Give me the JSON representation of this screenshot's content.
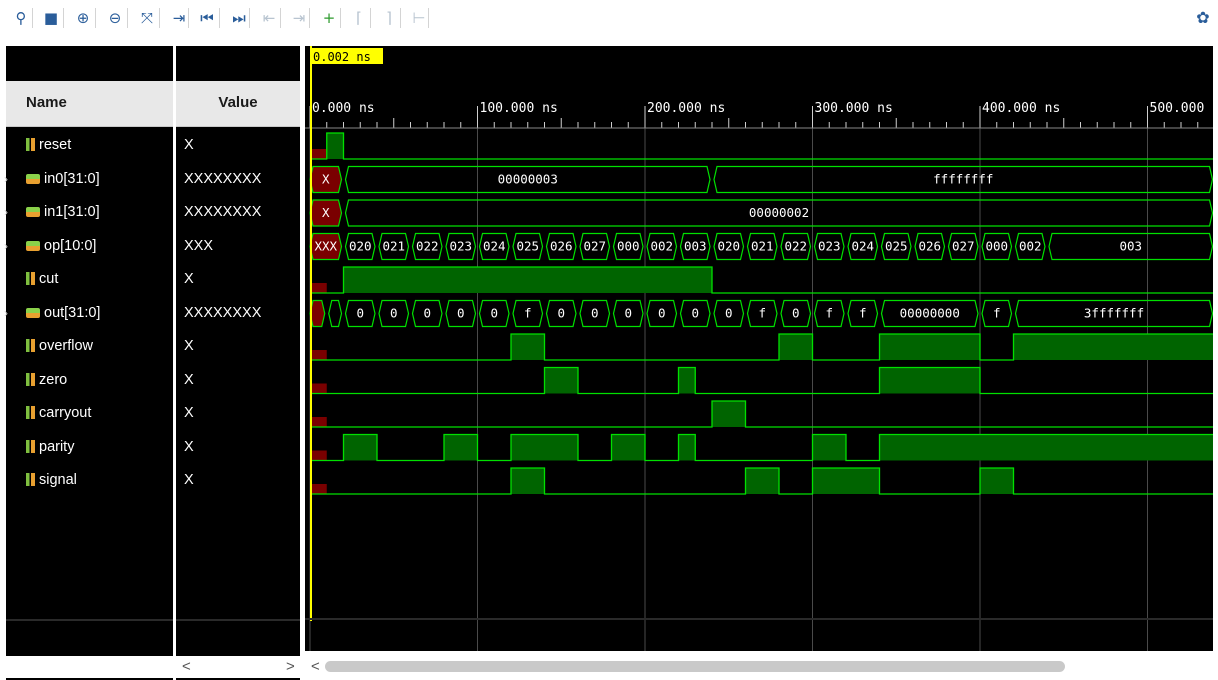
{
  "toolbar": {
    "buttons": [
      {
        "icon": "search-icon",
        "glyph": "⚲",
        "state": "enabled"
      },
      {
        "icon": "save-icon",
        "glyph": "■",
        "state": "enabled"
      },
      {
        "icon": "zoom-in-icon",
        "glyph": "⊕",
        "state": "enabled"
      },
      {
        "icon": "zoom-out-icon",
        "glyph": "⊖",
        "state": "enabled"
      },
      {
        "icon": "zoom-fit-icon",
        "glyph": "⤧",
        "state": "enabled"
      },
      {
        "icon": "go-to-cursor-icon",
        "glyph": "⇥",
        "state": "enabled"
      },
      {
        "icon": "go-to-time-zero-icon",
        "glyph": "⏮",
        "state": "enabled"
      },
      {
        "icon": "go-to-last-time-icon",
        "glyph": "⏭",
        "state": "enabled"
      },
      {
        "icon": "previous-transition-icon",
        "glyph": "⇤",
        "state": "disabled"
      },
      {
        "icon": "next-transition-icon",
        "glyph": "⇥",
        "state": "disabled"
      },
      {
        "icon": "add-marker-icon",
        "glyph": "+",
        "state": "green"
      },
      {
        "icon": "previous-marker-icon",
        "glyph": "⌈",
        "state": "disabled"
      },
      {
        "icon": "next-marker-icon",
        "glyph": "⌉",
        "state": "disabled"
      },
      {
        "icon": "swap-cursors-icon",
        "glyph": "⊢",
        "state": "disabled"
      }
    ],
    "settings_icon": "gear-icon"
  },
  "columns": {
    "name_header": "Name",
    "value_header": "Value"
  },
  "signals": [
    {
      "name": "reset",
      "value": "X",
      "kind": "bit",
      "expandable": false
    },
    {
      "name": "in0[31:0]",
      "value": "XXXXXXXX",
      "kind": "bus",
      "expandable": true
    },
    {
      "name": "in1[31:0]",
      "value": "XXXXXXXX",
      "kind": "bus",
      "expandable": true
    },
    {
      "name": "op[10:0]",
      "value": "XXX",
      "kind": "bus",
      "expandable": true
    },
    {
      "name": "cut",
      "value": "X",
      "kind": "bit",
      "expandable": false
    },
    {
      "name": "out[31:0]",
      "value": "XXXXXXXX",
      "kind": "bus",
      "expandable": true
    },
    {
      "name": "overflow",
      "value": "X",
      "kind": "bit",
      "expandable": false
    },
    {
      "name": "zero",
      "value": "X",
      "kind": "bit",
      "expandable": false
    },
    {
      "name": "carryout",
      "value": "X",
      "kind": "bit",
      "expandable": false
    },
    {
      "name": "parity",
      "value": "X",
      "kind": "bit",
      "expandable": false
    },
    {
      "name": "signal",
      "value": "X",
      "kind": "bit",
      "expandable": false
    }
  ],
  "timeline": {
    "cursor_label": "0.002 ns",
    "ticks": [
      "0.000 ns",
      "100.000 ns",
      "200.000 ns",
      "300.000 ns",
      "400.000 ns",
      "500.000"
    ],
    "t_max_ns": 540
  },
  "waves": {
    "reset": [
      [
        10,
        20
      ]
    ],
    "in0": [
      {
        "t0": 0,
        "t1": 20,
        "label": "X",
        "x": true
      },
      {
        "t0": 20,
        "t1": 240,
        "label": "00000003"
      },
      {
        "t0": 240,
        "t1": 540,
        "label": "ffffffff"
      }
    ],
    "in1": [
      {
        "t0": 0,
        "t1": 20,
        "label": "X",
        "x": true
      },
      {
        "t0": 20,
        "t1": 540,
        "label": "00000002"
      }
    ],
    "op": [
      {
        "t0": 0,
        "t1": 20,
        "label": "XXX",
        "x": true
      },
      {
        "t0": 20,
        "t1": 40,
        "label": "020"
      },
      {
        "t0": 40,
        "t1": 60,
        "label": "021"
      },
      {
        "t0": 60,
        "t1": 80,
        "label": "022"
      },
      {
        "t0": 80,
        "t1": 100,
        "label": "023"
      },
      {
        "t0": 100,
        "t1": 120,
        "label": "024"
      },
      {
        "t0": 120,
        "t1": 140,
        "label": "025"
      },
      {
        "t0": 140,
        "t1": 160,
        "label": "026"
      },
      {
        "t0": 160,
        "t1": 180,
        "label": "027"
      },
      {
        "t0": 180,
        "t1": 200,
        "label": "000"
      },
      {
        "t0": 200,
        "t1": 220,
        "label": "002"
      },
      {
        "t0": 220,
        "t1": 240,
        "label": "003"
      },
      {
        "t0": 240,
        "t1": 260,
        "label": "020"
      },
      {
        "t0": 260,
        "t1": 280,
        "label": "021"
      },
      {
        "t0": 280,
        "t1": 300,
        "label": "022"
      },
      {
        "t0": 300,
        "t1": 320,
        "label": "023"
      },
      {
        "t0": 320,
        "t1": 340,
        "label": "024"
      },
      {
        "t0": 340,
        "t1": 360,
        "label": "025"
      },
      {
        "t0": 360,
        "t1": 380,
        "label": "026"
      },
      {
        "t0": 380,
        "t1": 400,
        "label": "027"
      },
      {
        "t0": 400,
        "t1": 420,
        "label": "000"
      },
      {
        "t0": 420,
        "t1": 440,
        "label": "002"
      },
      {
        "t0": 440,
        "t1": 540,
        "label": "003"
      }
    ],
    "cut": [
      [
        20,
        240
      ]
    ],
    "out": [
      {
        "t0": 0,
        "t1": 10,
        "label": "",
        "x": true
      },
      {
        "t0": 10,
        "t1": 20,
        "label": ""
      },
      {
        "t0": 20,
        "t1": 40,
        "label": "0"
      },
      {
        "t0": 40,
        "t1": 60,
        "label": "0"
      },
      {
        "t0": 60,
        "t1": 80,
        "label": "0"
      },
      {
        "t0": 80,
        "t1": 100,
        "label": "0"
      },
      {
        "t0": 100,
        "t1": 120,
        "label": "0"
      },
      {
        "t0": 120,
        "t1": 140,
        "label": "f"
      },
      {
        "t0": 140,
        "t1": 160,
        "label": "0"
      },
      {
        "t0": 160,
        "t1": 180,
        "label": "0"
      },
      {
        "t0": 180,
        "t1": 200,
        "label": "0"
      },
      {
        "t0": 200,
        "t1": 220,
        "label": "0"
      },
      {
        "t0": 220,
        "t1": 240,
        "label": "0"
      },
      {
        "t0": 240,
        "t1": 260,
        "label": "0"
      },
      {
        "t0": 260,
        "t1": 280,
        "label": "f"
      },
      {
        "t0": 280,
        "t1": 300,
        "label": "0"
      },
      {
        "t0": 300,
        "t1": 320,
        "label": "f"
      },
      {
        "t0": 320,
        "t1": 340,
        "label": "f"
      },
      {
        "t0": 340,
        "t1": 400,
        "label": "00000000"
      },
      {
        "t0": 400,
        "t1": 420,
        "label": "f"
      },
      {
        "t0": 420,
        "t1": 540,
        "label": "3fffffff"
      }
    ],
    "overflow": [
      [
        120,
        140
      ],
      [
        280,
        300
      ],
      [
        340,
        400
      ],
      [
        420,
        540
      ]
    ],
    "zero": [
      [
        140,
        160
      ],
      [
        220,
        230
      ],
      [
        340,
        400
      ]
    ],
    "carryout": [
      [
        240,
        260
      ]
    ],
    "parity": [
      [
        20,
        40
      ],
      [
        80,
        100
      ],
      [
        120,
        160
      ],
      [
        180,
        200
      ],
      [
        220,
        230
      ],
      [
        300,
        320
      ],
      [
        340,
        540
      ]
    ],
    "signal": [
      [
        120,
        140
      ],
      [
        260,
        280
      ],
      [
        300,
        340
      ],
      [
        400,
        420
      ]
    ]
  },
  "colors": {
    "wave": "#00e000",
    "fill": "#006400",
    "xfill": "#7a0000",
    "cursor": "#ffff00",
    "grid": "#3a3a3a"
  }
}
